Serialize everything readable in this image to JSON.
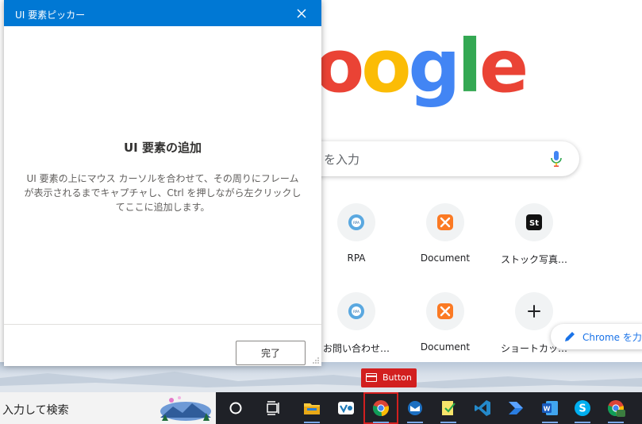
{
  "picker": {
    "title": "UI 要素ピッカー",
    "heading": "UI 要素の追加",
    "description": "UI 要素の上にマウス カーソルを合わせて、その周りにフレームが表示されるまでキャプチャし、Ctrl を押しながら左クリックしてここに追加します。",
    "done_label": "完了"
  },
  "chrome": {
    "logo_letters": [
      "o",
      "o",
      "g",
      "l",
      "e"
    ],
    "logo_colors": [
      "#ea4335",
      "#fbbc05",
      "#4285f4",
      "#34a853",
      "#ea4335"
    ],
    "search_placeholder": "を入力",
    "shortcuts": [
      {
        "label": "RPA",
        "icon": "rpa-gear-icon"
      },
      {
        "label": "Document",
        "icon": "document-xampp-icon"
      },
      {
        "label": "ストック写真…",
        "icon": "stock-st-icon"
      },
      {
        "label": "お問い合わせ…",
        "icon": "rpa-gear-icon"
      },
      {
        "label": "Document",
        "icon": "document-xampp-icon"
      },
      {
        "label": "ショートカッ…",
        "icon": "plus-icon"
      }
    ],
    "customize_label": "Chrome を力"
  },
  "element_tag": {
    "label": "Button"
  },
  "taskbar": {
    "search_placeholder": "入力して検索",
    "items": [
      "cortana-icon",
      "task-view-icon",
      "file-explorer-icon",
      "vbox-icon",
      "chrome-icon",
      "mail-icon",
      "notes-icon",
      "vscode-icon",
      "power-automate-icon",
      "word-icon",
      "skype-icon",
      "chrome-profile-icon"
    ]
  },
  "colors": {
    "dialog_title_bar": "#0078d4",
    "element_highlight": "#d21f1f",
    "taskbar": "#1f2127"
  }
}
